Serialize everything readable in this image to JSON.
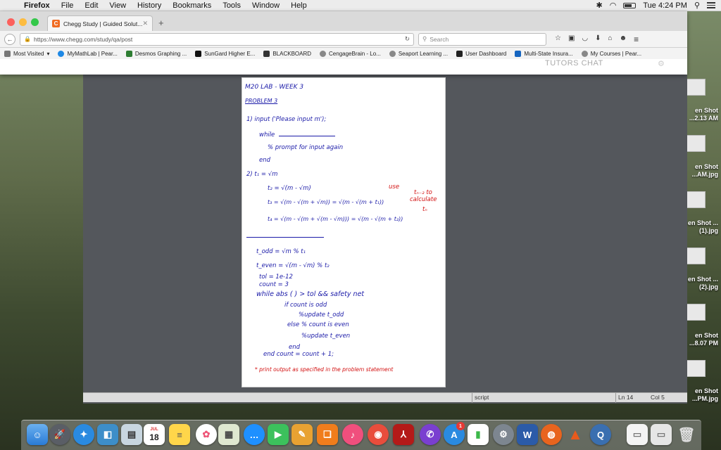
{
  "menubar": {
    "app": "Firefox",
    "items": [
      "File",
      "Edit",
      "View",
      "History",
      "Bookmarks",
      "Tools",
      "Window",
      "Help"
    ],
    "clock": "Tue 4:24 PM"
  },
  "browser": {
    "tab_title": "Chegg Study | Guided Solut...",
    "tab_favicon": "C",
    "url": "https://www.chegg.com/study/qa/post",
    "search_placeholder": "Search",
    "bookmarks": [
      {
        "label": "Most Visited",
        "color": "#777777"
      },
      {
        "label": "MyMathLab | Pear...",
        "color": "#1e88e5"
      },
      {
        "label": "Desmos Graphing ...",
        "color": "#2e7d32"
      },
      {
        "label": "SunGard Higher E...",
        "color": "#111111"
      },
      {
        "label": "BLACKBOARD",
        "color": "#333333"
      },
      {
        "label": "CengageBrain - Lo...",
        "color": "#888888"
      },
      {
        "label": "Seaport Learning ...",
        "color": "#888888"
      },
      {
        "label": "User Dashboard",
        "color": "#222222"
      },
      {
        "label": "Multi-State Insura...",
        "color": "#1565c0"
      },
      {
        "label": "My Courses | Pear...",
        "color": "#888888"
      }
    ],
    "page_tutors": "TUTORS CHAT"
  },
  "desktop_items": [
    {
      "label": "en Shot ...2.13 AM"
    },
    {
      "label": "en Shot ...AM.jpg"
    },
    {
      "label": "en Shot ...(1).jpg"
    },
    {
      "label": "en Shot ...(2).jpg"
    },
    {
      "label": "en Shot ...8.07 PM"
    },
    {
      "label": "en Shot ...PM.jpg"
    }
  ],
  "statusbar": {
    "mode": "script",
    "line": "Ln 14",
    "col": "Col 5"
  },
  "note": {
    "header": "M20 LAB - WEEK 3",
    "problem": "PROBLEM 3",
    "l1": "1) input ('Please input m');",
    "l2a": "while",
    "l3": "% prompt for input again",
    "l4": "end",
    "l5": "2) t₁ = √m",
    "l6": "t₂ = √(m - √m)",
    "l7": "t₃ = √(m - √(m + √m)) = √(m - √(m + t₁))",
    "l8": "t₄ = √(m - √(m + √(m - √m))) = √(m - √(m + t₂))",
    "r1": "use",
    "r2": "tₙ₋₂ to",
    "r3": "calculate",
    "r4": "tₙ",
    "l9": "t_odd = √m   % t₁",
    "l10": "t_even = √(m - √m)   % t₂",
    "l11": "tol = 1e-12",
    "l12": "count = 3",
    "l13": "while   abs (        ) > tol && safety net",
    "l14": "if  count is odd",
    "l15": "%update  t_odd",
    "l16": "else  % count is even",
    "l17": "%update  t_even",
    "l18": "end",
    "l19": "end   count = count + 1;",
    "l20": "* print output as specified in the problem statement"
  },
  "dock": {
    "calendar_day": "18",
    "calendar_month": "JUL",
    "badge": "1"
  }
}
